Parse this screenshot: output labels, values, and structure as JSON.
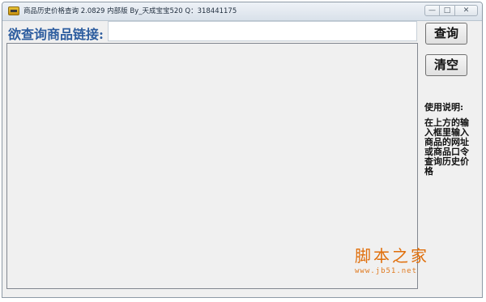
{
  "window": {
    "title": "商品历史价格查询 2.0829 内部版 By_天成宝宝520 Q：318441175",
    "controls": {
      "minimize": "—",
      "maximize": "□",
      "close": "✕"
    }
  },
  "query": {
    "label": "欲查询商品链接:",
    "input_value": "",
    "placeholder": ""
  },
  "buttons": {
    "query_label": "查询",
    "clear_label": "清空"
  },
  "help": {
    "title": "使用说明:",
    "body": "在上方的输入框里输入商品的网址或商品口令查询历史价格"
  },
  "watermark": {
    "main": "脚本之家",
    "sub": "www.jb51.net"
  },
  "colors": {
    "label_blue": "#2d5d9f",
    "watermark_orange": "#e06e0a"
  },
  "icons": {
    "app": "app-icon"
  }
}
